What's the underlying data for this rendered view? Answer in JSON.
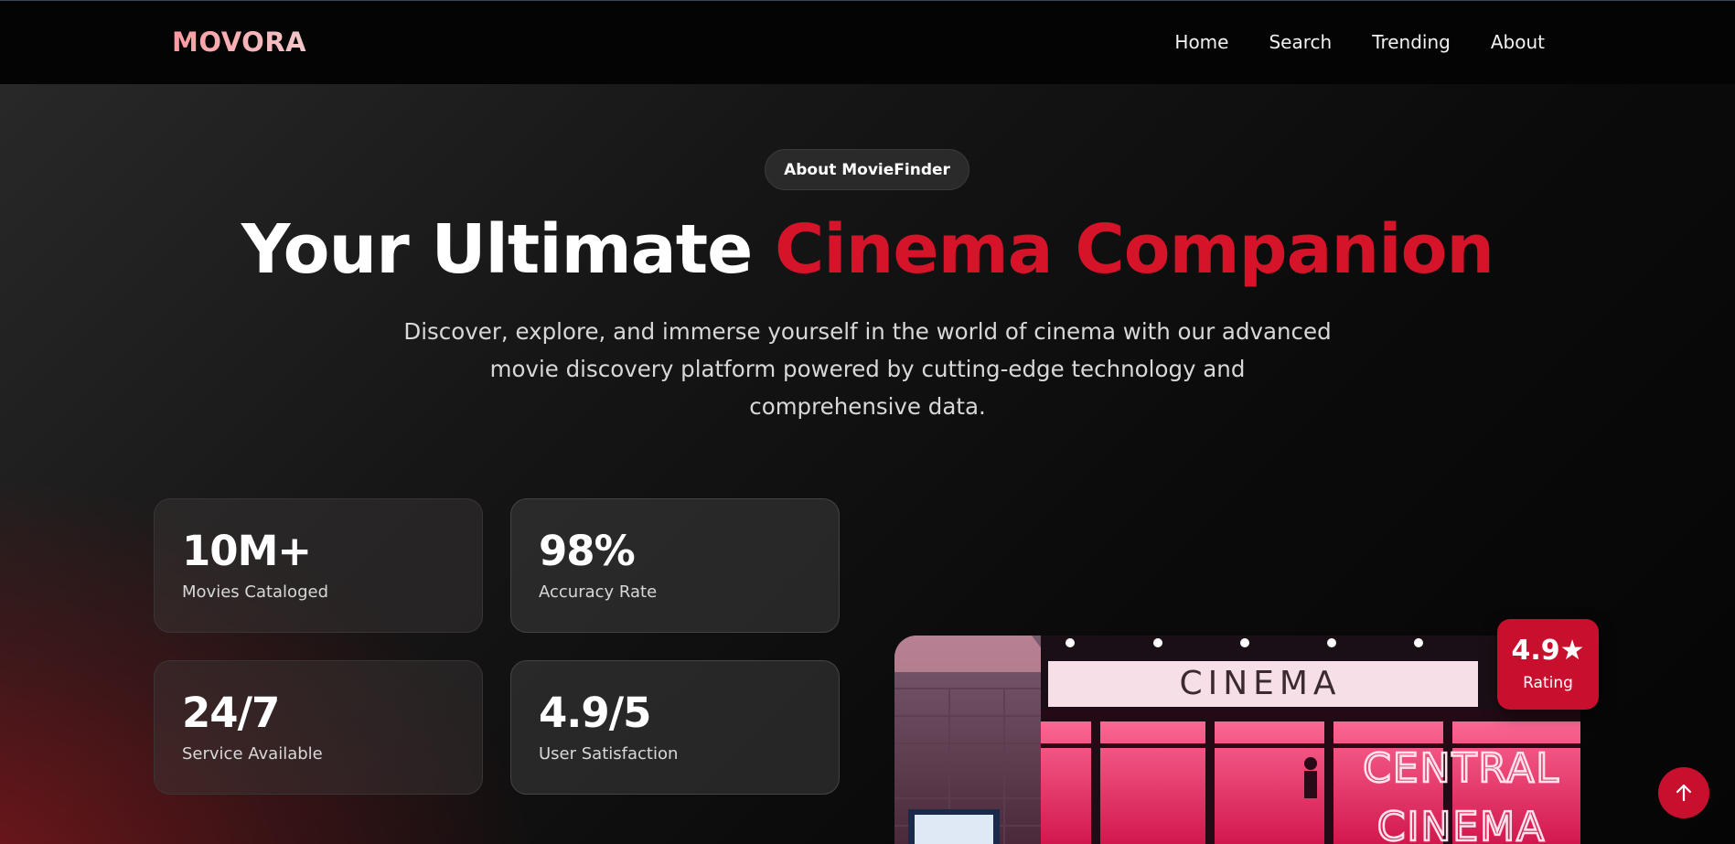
{
  "brand": {
    "logo": "MOVORA"
  },
  "nav": {
    "items": [
      {
        "label": "Home"
      },
      {
        "label": "Search"
      },
      {
        "label": "Trending"
      },
      {
        "label": "About"
      }
    ]
  },
  "hero": {
    "badge": "About MovieFinder",
    "title_white": "Your Ultimate",
    "title_red": "Cinema Companion",
    "subtitle": "Discover, explore, and immerse yourself in the world of cinema with our advanced movie discovery platform powered by cutting-edge technology and comprehensive data."
  },
  "stats": [
    {
      "value": "10M+",
      "label": "Movies Cataloged"
    },
    {
      "value": "98%",
      "label": "Accuracy Rate"
    },
    {
      "value": "24/7",
      "label": "Service Available"
    },
    {
      "value": "4.9/5",
      "label": "User Satisfaction"
    }
  ],
  "image": {
    "sign_top": "CINEMA",
    "neon_line1": "CENTRAL",
    "neon_line2": "CINEMA"
  },
  "rating_badge": {
    "value": "4.9★",
    "label": "Rating"
  },
  "colors": {
    "accent": "#c8102e",
    "title_red": "#d5142a",
    "background": "#0b0b0b"
  },
  "icons": {
    "scroll_top": "arrow-up-icon"
  }
}
